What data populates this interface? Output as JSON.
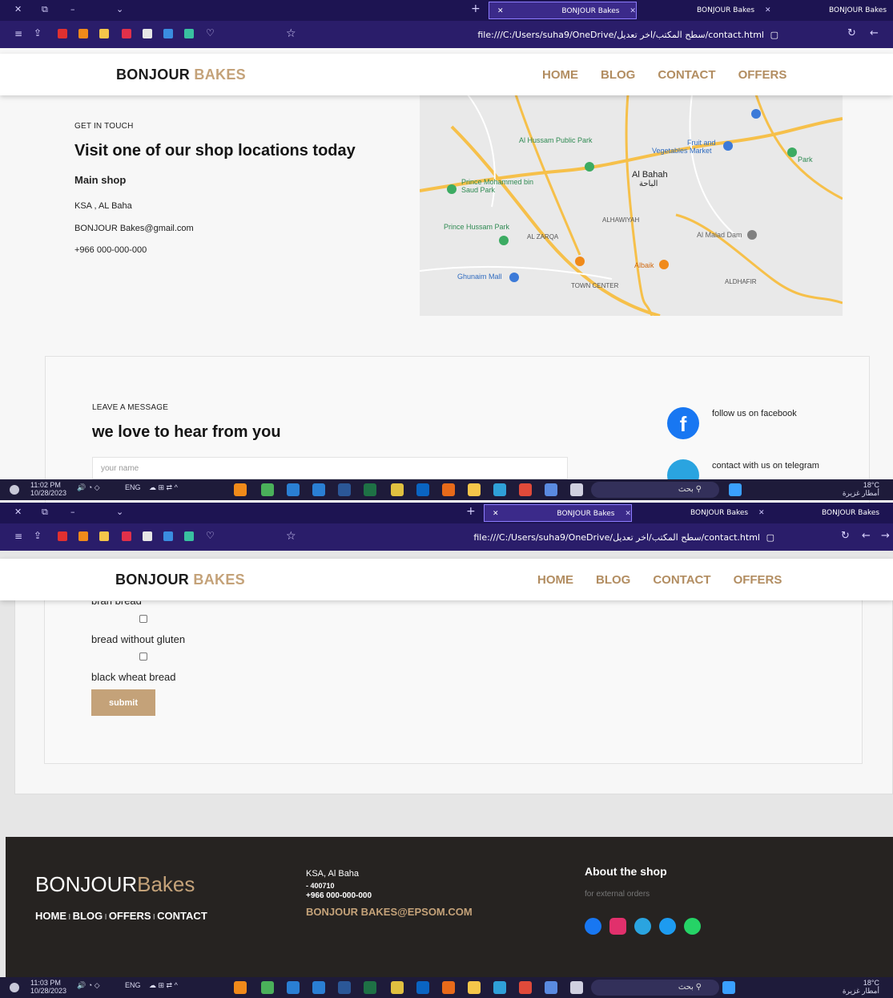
{
  "browser": {
    "tabs": [
      "BONJOUR Bakes",
      "BONJOUR Bakes",
      "BONJOUR Bakes"
    ],
    "url": "file:///C:/Users/suha9/OneDrive/سطح المكتب/اخر تعديل/contact.html"
  },
  "site": {
    "brand_main": "BONJOUR",
    "brand_accent": "BAKES",
    "nav": [
      "HOME",
      "BLOG",
      "CONTACT",
      "OFFERS"
    ]
  },
  "contact": {
    "eyebrow": "GET IN TOUCH",
    "title": "Visit one of our shop locations today",
    "shop_heading": "Main shop",
    "address": "KSA , AL Baha",
    "email": "BONJOUR Bakes@gmail.com",
    "phone": "+966 000-000-000"
  },
  "map": {
    "labels": [
      "Al Hussam Public Park",
      "Vegetables Market",
      "Fruit and",
      "Al Bahah",
      "Prince Mohammed bin Saud Park",
      "Prince Hussam Park",
      "AL ZARQA",
      "ALHAWIYAH",
      "Al Malad Dam",
      "Albaik",
      "Ghunaim Mall",
      "TOWN CENTER",
      "ALDHAFIR",
      "الباحة",
      "Park"
    ]
  },
  "message": {
    "eyebrow": "LEAVE A MESSAGE",
    "title": "we love to hear from you",
    "name_placeholder": "your name",
    "social_facebook": "follow us on facebook",
    "social_telegram": "contact with us on telegram"
  },
  "form": {
    "options": [
      "bran bread",
      "bread without gluten",
      "black wheat bread"
    ],
    "submit_label": "submit"
  },
  "footer": {
    "logo_main": "BONJOUR",
    "logo_accent": "Bakes",
    "links": [
      "HOME",
      "BLOG",
      "OFFERS",
      "CONTACT"
    ],
    "address": "KSA, Al Baha",
    "postal": "- 400710",
    "phone": "+966 000-000-000",
    "email": "BONJOUR BAKES@EPSOM.COM",
    "about_title": "About the shop",
    "about_sub": "for external orders"
  },
  "taskbar": [
    {
      "time": "11:02 PM",
      "date": "10/28/2023",
      "lang": "ENG",
      "temp": "18°C",
      "weather": "أمطار غزيرة",
      "search": "بحث"
    },
    {
      "time": "11:03 PM",
      "date": "10/28/2023",
      "lang": "ENG",
      "temp": "18°C",
      "weather": "أمطار غزيرة",
      "search": "بحث"
    }
  ],
  "colors": {
    "accent": "#c4a279",
    "nav_text": "#b28d61",
    "footer_bg": "#262321",
    "browser_bg": "#1d1452"
  }
}
